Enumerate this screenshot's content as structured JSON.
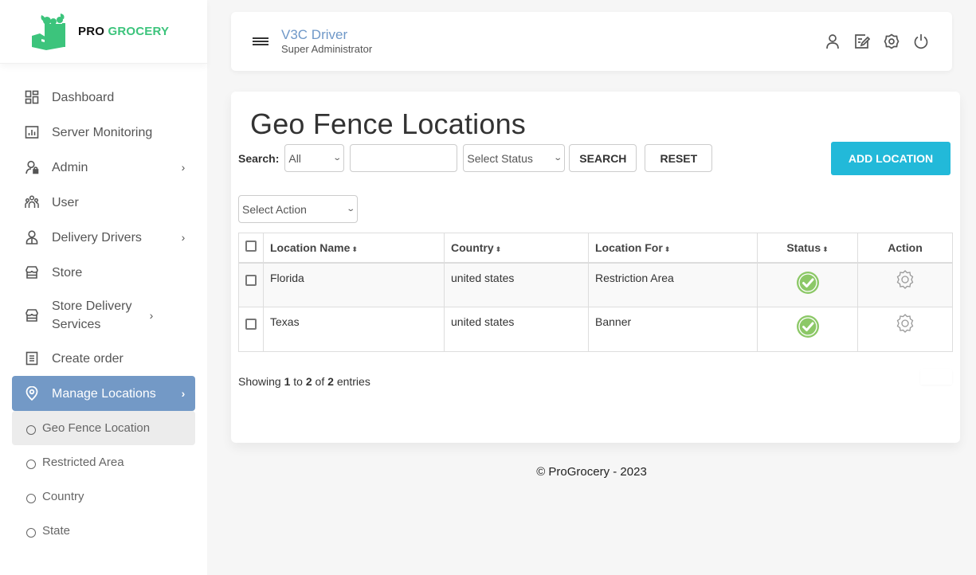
{
  "brand": {
    "pro": "PRO",
    "grocery": "GROCERY",
    "accent": "#3cc47c"
  },
  "sidebar": {
    "items": [
      {
        "label": "Dashboard",
        "icon": "dashboard-icon",
        "chevron": false
      },
      {
        "label": "Server Monitoring",
        "icon": "chart-icon",
        "chevron": false
      },
      {
        "label": "Admin",
        "icon": "user-lock-icon",
        "chevron": true
      },
      {
        "label": "User",
        "icon": "users-icon",
        "chevron": true
      },
      {
        "label": "Delivery Drivers",
        "icon": "driver-icon",
        "chevron": true
      },
      {
        "label": "Store",
        "icon": "store-icon",
        "chevron": false
      },
      {
        "label": "Store Delivery Services",
        "icon": "store-icon",
        "chevron": true
      },
      {
        "label": "Create order",
        "icon": "document-icon",
        "chevron": false
      },
      {
        "label": "Manage Locations",
        "icon": "location-pin-icon",
        "chevron": true,
        "active": true
      }
    ],
    "chevron_glyph": "›",
    "subitems": [
      {
        "label": "Geo Fence Location",
        "active": true
      },
      {
        "label": "Restricted Area"
      },
      {
        "label": "Country"
      },
      {
        "label": "State"
      }
    ]
  },
  "header": {
    "user_name": "V3C Driver",
    "user_role": "Super Administrator",
    "icons": [
      "profile-icon",
      "edit-icon",
      "settings-icon",
      "power-icon"
    ]
  },
  "main": {
    "title": "Geo Fence Locations",
    "search_label": "Search:",
    "search_field_select": "All",
    "search_input_value": "",
    "status_select": "Select Status",
    "search_button": "SEARCH",
    "reset_button": "RESET",
    "add_button": "ADD LOCATION",
    "action_select": "Select Action",
    "caret": "⌄",
    "sort_glyph": "⬍",
    "table": {
      "columns": [
        "Location Name",
        "Country",
        "Location For",
        "Status",
        "Action"
      ],
      "rows": [
        {
          "name": "Florida",
          "country": "united states",
          "location_for": "Restriction Area",
          "status": "active"
        },
        {
          "name": "Texas",
          "country": "united states",
          "location_for": "Banner",
          "status": "active"
        }
      ]
    },
    "info": {
      "prefix": "Showing",
      "from": "1",
      "to_word": "to",
      "to": "2",
      "of_word": "of",
      "total": "2",
      "suffix": "entries"
    },
    "status_color": "#8cc867",
    "add_button_color": "#22b9d9"
  },
  "footer": {
    "text": "© ProGrocery - 2023"
  }
}
